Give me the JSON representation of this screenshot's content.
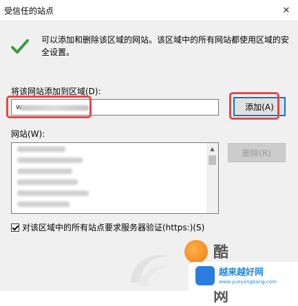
{
  "window": {
    "title": "受信任的站点",
    "close_glyph": "✕"
  },
  "info": {
    "text": "可以添加和删除该区域的网站。该区域中的所有网站都使用区域的安全设置。"
  },
  "add_section": {
    "label": "将该网站添加到区域(D):",
    "input_value": "w",
    "add_button": "添加(A)"
  },
  "sites_section": {
    "label": "网站(W):",
    "remove_button": "删除(R)"
  },
  "checkbox": {
    "label": "对该区域中的所有站点要求服务器验证(https:)(S)",
    "checked": true
  },
  "watermark": {
    "brand": "酷知网",
    "badge_title": "越来越好网",
    "badge_url": "www.yueyangbang.com"
  },
  "colors": {
    "highlight": "#e04848",
    "accent": "#0078d7",
    "check": "#3c9a3c"
  }
}
